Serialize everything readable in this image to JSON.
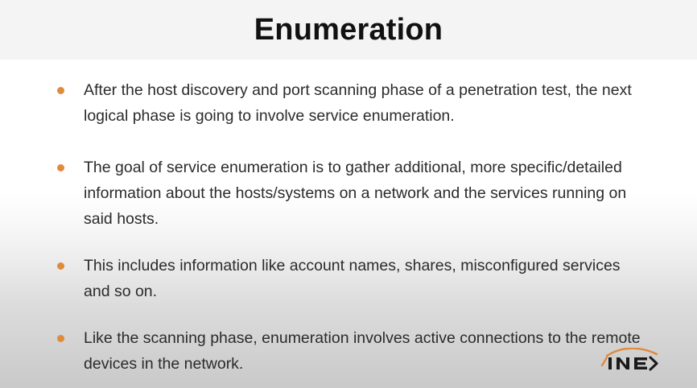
{
  "slide": {
    "title": "Enumeration",
    "bullets": [
      {
        "text": "After the host discovery and port scanning phase of a penetration test, the next logical phase is going to involve service enumeration."
      },
      {
        "text": "The goal of service enumeration is to gather additional, more specific/detailed information about the hosts/systems on a network and the services running on said hosts."
      },
      {
        "text": "This includes information like account names, shares, misconfigured services and so on."
      },
      {
        "text": "Like the scanning phase, enumeration involves active connections to the remote devices in the network."
      }
    ],
    "logo_text": "INE"
  },
  "colors": {
    "bullet_accent": "#e08a3c",
    "title_bar_background": "#f4f4f4",
    "text": "#2b2b2b",
    "logo_dark": "#1a1a1a"
  }
}
